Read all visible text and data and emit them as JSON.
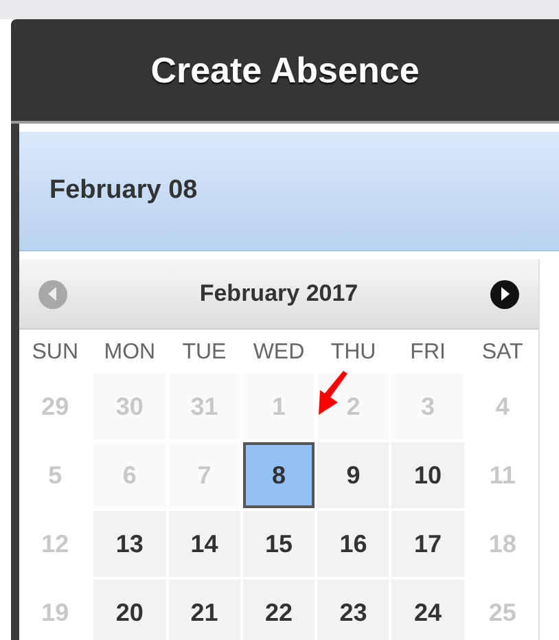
{
  "header": {
    "title": "Create Absence"
  },
  "selected_date": "February 08",
  "calendar": {
    "month": "February 2017",
    "prev": {
      "disabled": true
    },
    "next": {
      "disabled": false
    },
    "weekdays": [
      "SUN",
      "MON",
      "TUE",
      "WED",
      "THU",
      "FRI",
      "SAT"
    ],
    "weeks": [
      [
        {
          "day": "29",
          "disabled": true,
          "selected": false
        },
        {
          "day": "30",
          "disabled": true,
          "selected": false
        },
        {
          "day": "31",
          "disabled": true,
          "selected": false
        },
        {
          "day": "1",
          "disabled": true,
          "selected": false
        },
        {
          "day": "2",
          "disabled": true,
          "selected": false
        },
        {
          "day": "3",
          "disabled": true,
          "selected": false
        },
        {
          "day": "4",
          "disabled": true,
          "selected": false
        }
      ],
      [
        {
          "day": "5",
          "disabled": true,
          "selected": false
        },
        {
          "day": "6",
          "disabled": true,
          "selected": false
        },
        {
          "day": "7",
          "disabled": true,
          "selected": false
        },
        {
          "day": "8",
          "disabled": false,
          "selected": true
        },
        {
          "day": "9",
          "disabled": false,
          "selected": false
        },
        {
          "day": "10",
          "disabled": false,
          "selected": false
        },
        {
          "day": "11",
          "disabled": true,
          "selected": false
        }
      ],
      [
        {
          "day": "12",
          "disabled": true,
          "selected": false
        },
        {
          "day": "13",
          "disabled": false,
          "selected": false
        },
        {
          "day": "14",
          "disabled": false,
          "selected": false
        },
        {
          "day": "15",
          "disabled": false,
          "selected": false
        },
        {
          "day": "16",
          "disabled": false,
          "selected": false
        },
        {
          "day": "17",
          "disabled": false,
          "selected": false
        },
        {
          "day": "18",
          "disabled": true,
          "selected": false
        }
      ],
      [
        {
          "day": "19",
          "disabled": true,
          "selected": false
        },
        {
          "day": "20",
          "disabled": false,
          "selected": false
        },
        {
          "day": "21",
          "disabled": false,
          "selected": false
        },
        {
          "day": "22",
          "disabled": false,
          "selected": false
        },
        {
          "day": "23",
          "disabled": false,
          "selected": false
        },
        {
          "day": "24",
          "disabled": false,
          "selected": false
        },
        {
          "day": "25",
          "disabled": true,
          "selected": false
        }
      ]
    ]
  }
}
